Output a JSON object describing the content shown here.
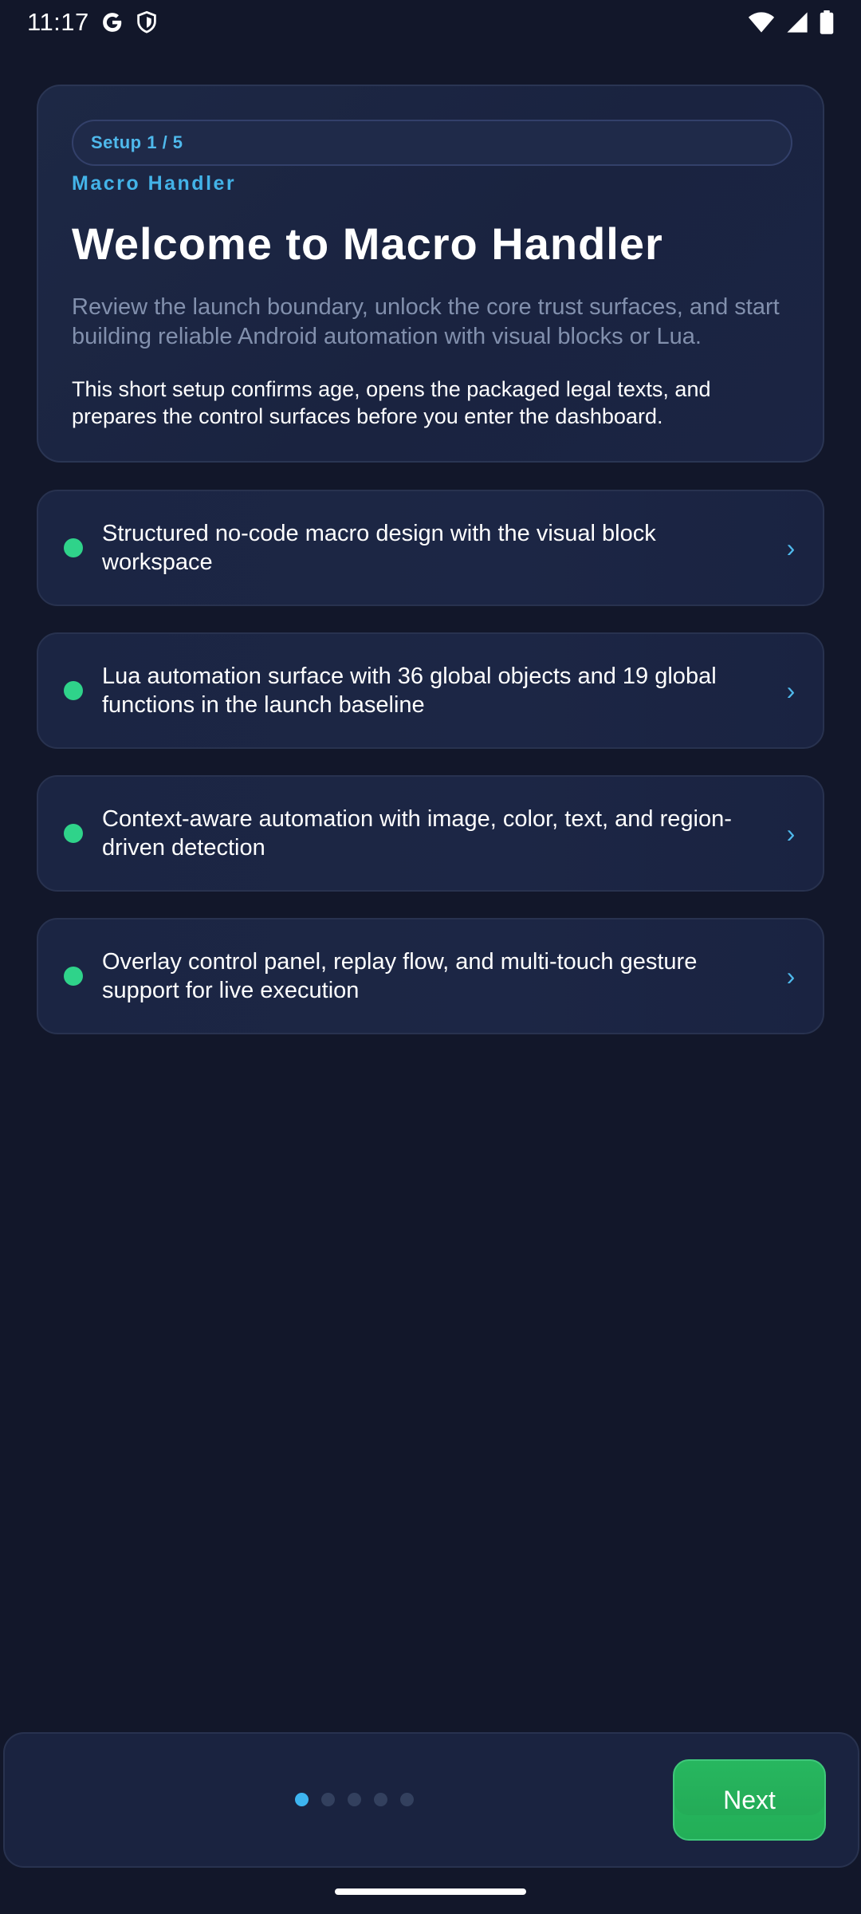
{
  "status_bar": {
    "time": "11:17",
    "icons_left": [
      "google-g-icon",
      "shield-icon"
    ],
    "icons_right": [
      "wifi-icon",
      "signal-icon",
      "battery-icon"
    ]
  },
  "hero": {
    "setup_step": "Setup 1 / 5",
    "app_label": "Macro Handler",
    "title": "Welcome to Macro Handler",
    "subtitle": "Review the launch boundary, unlock the core trust surfaces, and start building reliable Android automation with visual blocks or Lua.",
    "body": "This short setup confirms age, opens the packaged legal texts, and prepares the control surfaces before you enter the dashboard."
  },
  "features": [
    {
      "text": "Structured no-code macro design with the visual block workspace"
    },
    {
      "text": "Lua automation surface with 36 global objects and 19 global functions in the launch baseline"
    },
    {
      "text": "Context-aware automation with image, color, text, and region-driven detection"
    },
    {
      "text": "Overlay control panel, replay flow, and multi-touch gesture support for live execution"
    }
  ],
  "footer": {
    "pager_total": 5,
    "pager_current": 1,
    "next_label": "Next"
  },
  "colors": {
    "background": "#12172a",
    "card": "#1b2543",
    "accent_blue": "#43b3e8",
    "accent_green": "#2fd38a",
    "button_green": "#27b75f"
  }
}
